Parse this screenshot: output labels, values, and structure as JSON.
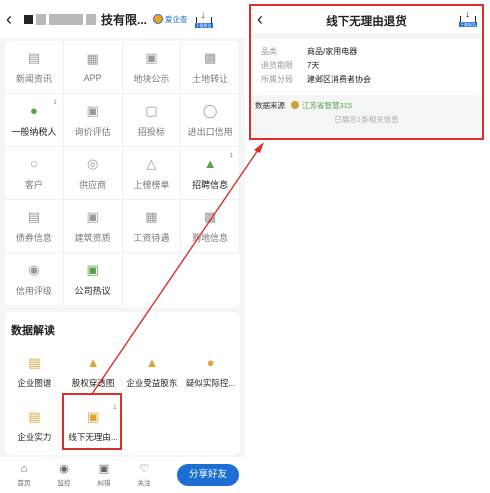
{
  "left": {
    "header": {
      "back_icon": "chevron-left-icon",
      "company_suffix": "技有限...",
      "badge_label": "爱企查",
      "download_label": "下载报告"
    },
    "grid": [
      {
        "label": "新闻资讯",
        "icon": "news-icon",
        "active": false,
        "sup": ""
      },
      {
        "label": "APP",
        "icon": "app-icon",
        "active": false,
        "sup": ""
      },
      {
        "label": "地块公示",
        "icon": "land-icon",
        "active": false,
        "sup": ""
      },
      {
        "label": "土地转让",
        "icon": "land-transfer-icon",
        "active": false,
        "sup": ""
      },
      {
        "label": "一般纳税人",
        "icon": "taxpayer-icon",
        "active": true,
        "sup": "1"
      },
      {
        "label": "询价评估",
        "icon": "inquiry-icon",
        "active": false,
        "sup": ""
      },
      {
        "label": "招投标",
        "icon": "bidding-icon",
        "active": false,
        "sup": ""
      },
      {
        "label": "进出口信用",
        "icon": "import-export-icon",
        "active": false,
        "sup": ""
      },
      {
        "label": "客户",
        "icon": "customer-icon",
        "active": false,
        "sup": ""
      },
      {
        "label": "供应商",
        "icon": "supplier-icon",
        "active": false,
        "sup": ""
      },
      {
        "label": "上榜榜单",
        "icon": "trophy-icon",
        "active": false,
        "sup": ""
      },
      {
        "label": "招聘信息",
        "icon": "recruit-icon",
        "active": true,
        "sup": "1"
      },
      {
        "label": "债券信息",
        "icon": "bond-icon",
        "active": false,
        "sup": ""
      },
      {
        "label": "建筑资质",
        "icon": "building-icon",
        "active": false,
        "sup": ""
      },
      {
        "label": "工资待遇",
        "icon": "salary-icon",
        "active": false,
        "sup": ""
      },
      {
        "label": "购地信息",
        "icon": "land-purchase-icon",
        "active": false,
        "sup": ""
      },
      {
        "label": "信用评级",
        "icon": "credit-icon",
        "active": false,
        "sup": ""
      },
      {
        "label": "公司热议",
        "icon": "discussion-icon",
        "active": true,
        "sup": ""
      }
    ],
    "data_section": {
      "title": "数据解读",
      "items": [
        {
          "label": "企业图谱",
          "icon": "graph-icon",
          "sup": ""
        },
        {
          "label": "股权穿透图",
          "icon": "equity-icon",
          "sup": ""
        },
        {
          "label": "企业受益股东",
          "icon": "beneficiary-icon",
          "sup": ""
        },
        {
          "label": "疑似实际控...",
          "icon": "controller-icon",
          "sup": ""
        },
        {
          "label": "企业实力",
          "icon": "strength-icon",
          "sup": ""
        },
        {
          "label": "线下无理由...",
          "icon": "return-icon",
          "sup": "1"
        }
      ]
    },
    "tabbar": {
      "tabs": [
        {
          "label": "首页",
          "icon": "home-icon"
        },
        {
          "label": "监控",
          "icon": "eye-icon"
        },
        {
          "label": "纠错",
          "icon": "correct-icon"
        },
        {
          "label": "关注",
          "icon": "heart-icon"
        }
      ],
      "share_label": "分享好友"
    }
  },
  "right": {
    "title": "线下无理由退货",
    "download_label": "下载报告",
    "rows": [
      {
        "k": "品类",
        "v": "商品/家用电器"
      },
      {
        "k": "退货期限",
        "v": "7天"
      },
      {
        "k": "所属分局",
        "v": "建邺区消费者协会"
      }
    ],
    "source_label": "数据来源",
    "source_org": "江苏省智慧315",
    "shown_text": "已展示1条相关信息"
  },
  "colors": {
    "accent": "#1d6fd6",
    "highlight": "#d9302a",
    "green": "#5aa14a",
    "gold": "#e0a43a"
  }
}
